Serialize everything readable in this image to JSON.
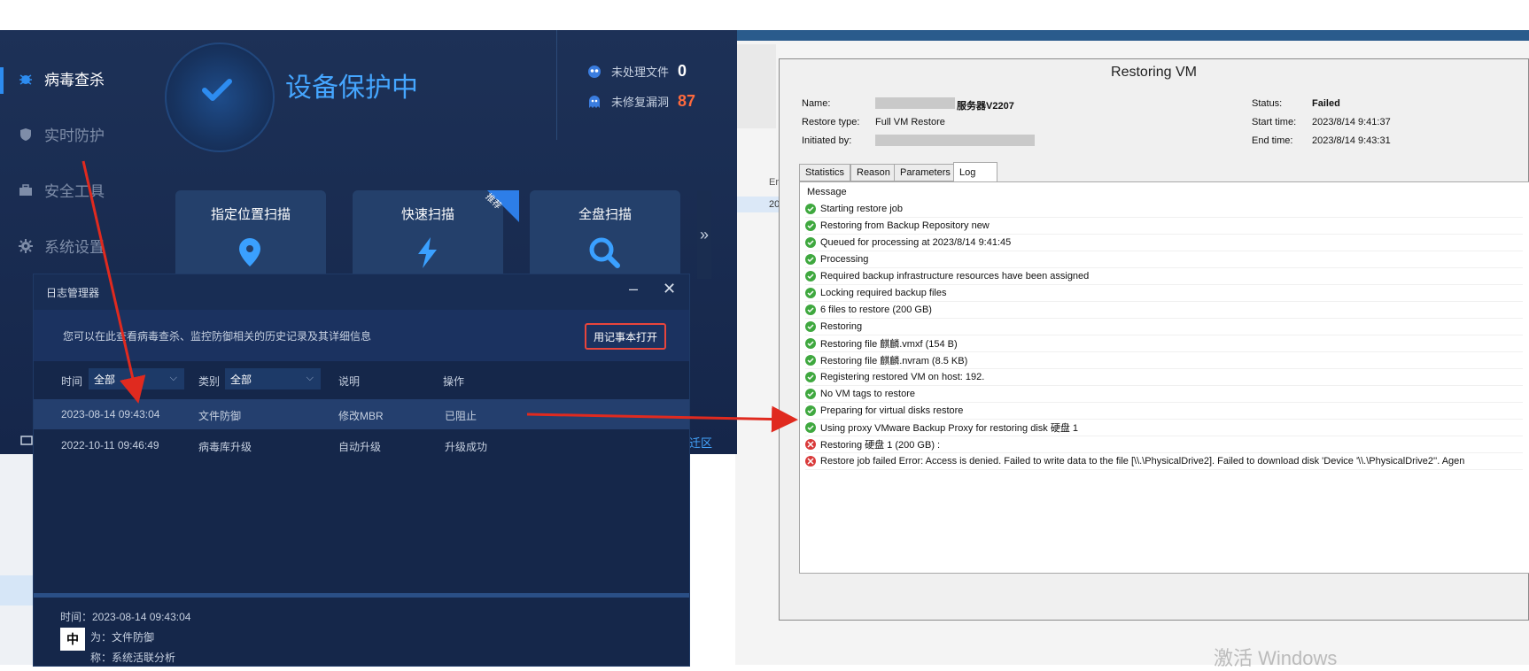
{
  "av": {
    "sidebar": [
      {
        "label": "病毒查杀",
        "icon": "bug-icon",
        "active": true
      },
      {
        "label": "实时防护",
        "icon": "shield-icon",
        "active": false
      },
      {
        "label": "安全工具",
        "icon": "toolbox-icon",
        "active": false
      },
      {
        "label": "系统设置",
        "icon": "gear-icon",
        "active": false
      }
    ],
    "status_title": "设备保护中",
    "stats": [
      {
        "label": "未处理文件",
        "value": "0",
        "color": "#ffffff",
        "icon": "virus-icon"
      },
      {
        "label": "未修复漏洞",
        "value": "87",
        "color": "#ff6a3d",
        "icon": "ghost-icon"
      }
    ],
    "scan_cards": [
      {
        "label": "指定位置扫描",
        "icon": "location-pin-icon"
      },
      {
        "label": "快速扫描",
        "icon": "lightning-icon",
        "badge": "推荐"
      },
      {
        "label": "全盘扫描",
        "icon": "magnifier-icon"
      }
    ],
    "more_label": "»",
    "bottom_link": "迁区"
  },
  "log_dialog": {
    "title": "日志管理器",
    "min_label": "–",
    "close_label": "✕",
    "info_text": "您可以在此查看病毒查杀、监控防御相关的历史记录及其详细信息",
    "notepad_button": "用记事本打开",
    "filters": {
      "time_label": "时间",
      "time_value": "全部",
      "category_label": "类别",
      "category_value": "全部",
      "desc_label": "说明",
      "action_label": "操作"
    },
    "rows": [
      {
        "time": "2023-08-14 09:43:04",
        "category": "文件防御",
        "desc": "修改MBR",
        "action": "已阻止"
      },
      {
        "time": "2022-10-11 09:46:49",
        "category": "病毒库升级",
        "desc": "自动升级",
        "action": "升级成功"
      }
    ],
    "detail": {
      "line1": "时间：2023-08-14 09:43:04",
      "line2": "为：文件防御",
      "line3": "称：系统活联分析"
    },
    "ime_label": "中"
  },
  "veeam": {
    "title": "Restoring VM",
    "name_label": "Name:",
    "name_value": "服务器V2207",
    "restore_type_label": "Restore type:",
    "restore_type_value": "Full VM Restore",
    "initiated_label": "Initiated by:",
    "status_label": "Status:",
    "status_value": "Failed",
    "start_label": "Start time:",
    "start_value": "2023/8/14 9:41:37",
    "end_label": "End time:",
    "end_value": "2023/8/14 9:43:31",
    "tabs": [
      "Statistics",
      "Reason",
      "Parameters",
      "Log"
    ],
    "active_tab": "Log",
    "log_header": "Message",
    "log": [
      {
        "status": "ok",
        "text": "Starting restore job"
      },
      {
        "status": "ok",
        "text": "Restoring from Backup Repository new"
      },
      {
        "status": "ok",
        "text": "Queued for processing at 2023/8/14 9:41:45"
      },
      {
        "status": "ok",
        "text": "Processing"
      },
      {
        "status": "ok",
        "text": "Required backup infrastructure resources have been assigned"
      },
      {
        "status": "ok",
        "text": "Locking required backup files"
      },
      {
        "status": "ok",
        "text": "6 files to restore (200 GB)"
      },
      {
        "status": "ok",
        "text": "Restoring"
      },
      {
        "status": "ok",
        "text": "Restoring file 麒麟.vmxf (154 B)"
      },
      {
        "status": "ok",
        "text": "Restoring file 麒麟.nvram (8.5 KB)"
      },
      {
        "status": "ok",
        "text": "Registering restored VM on host: 192."
      },
      {
        "status": "ok",
        "text": "No VM tags to restore"
      },
      {
        "status": "ok",
        "text": "Preparing for virtual disks restore"
      },
      {
        "status": "ok",
        "text": "Using proxy VMware Backup Proxy for restoring disk 硬盘 1"
      },
      {
        "status": "err",
        "text": "Restoring 硬盘 1 (200 GB) :"
      },
      {
        "status": "err",
        "text": "Restore job failed Error: Access is denied. Failed to write data to the file [\\\\.\\PhysicalDrive2]. Failed to download disk 'Device '\\\\.\\PhysicalDrive2''. Agen"
      }
    ]
  },
  "background": {
    "er_label": "Er",
    "row_label": "20",
    "watermark": "激活 Windows"
  },
  "colors": {
    "accent_blue": "#45a6ff",
    "alert_red": "#e8453c",
    "ok_green": "#3fa83f",
    "error_red": "#d93a3a",
    "arrow_red": "#e02a1f"
  }
}
